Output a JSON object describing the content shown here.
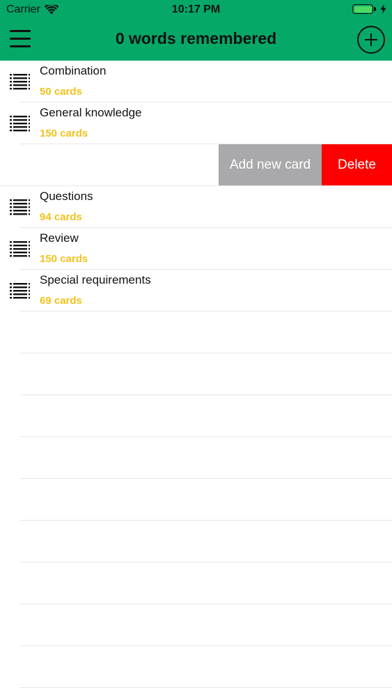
{
  "status_bar": {
    "carrier": "Carrier",
    "time": "10:17 PM",
    "battery_color": "#4cd964"
  },
  "header": {
    "title": "0 words remembered",
    "background_color": "#05a867",
    "menu_icon": "hamburger-menu-icon",
    "add_icon": "plus-circle-icon"
  },
  "decks": [
    {
      "name": "Combination",
      "count": "50 cards"
    },
    {
      "name": "General knowledge",
      "count": "150 cards"
    },
    {
      "name": "Questions",
      "count": "94 cards"
    },
    {
      "name": "Review",
      "count": "150 cards"
    },
    {
      "name": "Special requirements",
      "count": "69 cards"
    }
  ],
  "swipe_actions": {
    "add_label": "Add new card",
    "delete_label": "Delete",
    "add_color": "#a9a8aa",
    "delete_color": "#fe0000"
  },
  "colors": {
    "count_text": "#f2c21b"
  },
  "deck_icon": "list-icon"
}
